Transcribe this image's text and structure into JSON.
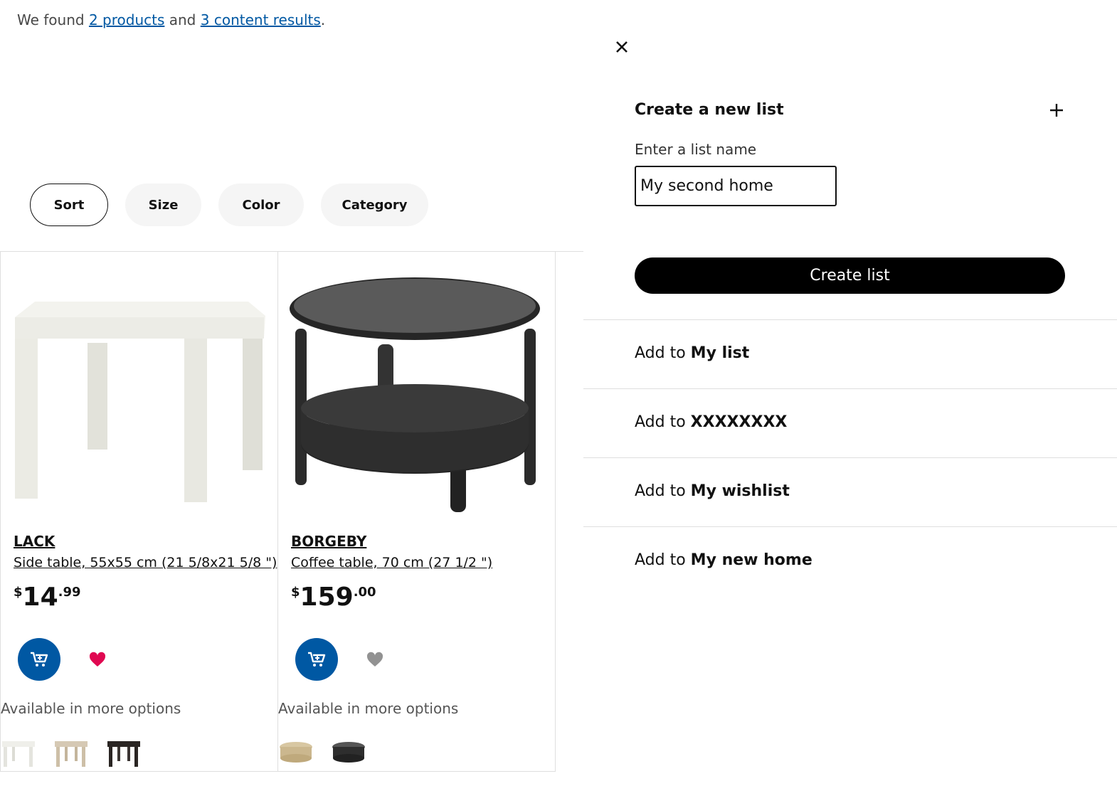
{
  "search": {
    "summary_prefix": "We found",
    "products_link": "2 products",
    "summary_mid": "and",
    "content_link": "3 content results",
    "summary_suffix": "."
  },
  "filters": [
    "Sort",
    "Size",
    "Color",
    "Category"
  ],
  "products": [
    {
      "name": "LACK",
      "description": "Side table, 55x55 cm (21 5/8x21 5/8 \")",
      "currency": "$",
      "price_int": "14",
      "price_dec": ".99",
      "favorited": true,
      "more_options": "Available in more options",
      "variants": [
        "white",
        "white-stained-oak",
        "black-brown"
      ]
    },
    {
      "name": "BORGEBY",
      "description": "Coffee table, 70 cm (27 1/2 \")",
      "currency": "$",
      "price_int": "159",
      "price_dec": ".00",
      "favorited": false,
      "more_options": "Available in more options",
      "variants": [
        "birch-veneer",
        "black"
      ]
    }
  ],
  "panel": {
    "create_heading": "Create a new list",
    "field_label": "Enter a list name",
    "input_value": "My second home",
    "create_button": "Create list",
    "add_prefix": "Add to",
    "lists": [
      "My list",
      "XXXXXXXX",
      "My wishlist",
      "My new home"
    ]
  },
  "colors": {
    "accent_blue": "#0058a3",
    "favorite_red": "#e00751",
    "heart_gray": "#929292"
  }
}
